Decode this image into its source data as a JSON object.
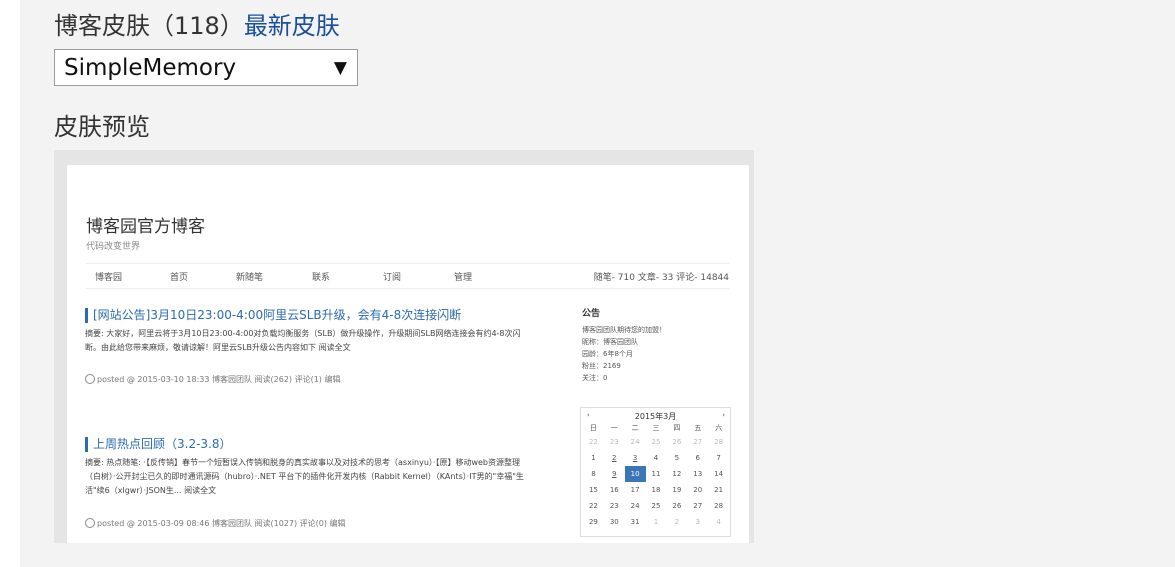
{
  "header": {
    "label": "博客皮肤（118）",
    "link": "最新皮肤"
  },
  "skin_select": {
    "value": "SimpleMemory",
    "arrow": "▼"
  },
  "preview": {
    "title": "皮肤预览",
    "blog": {
      "title": "博客园官方博客",
      "subtitle": "代码改变世界",
      "nav": [
        "博客园",
        "首页",
        "新随笔",
        "联系",
        "订阅",
        "管理"
      ],
      "stats": "随笔- 710  文章- 33  评论- 14844",
      "posts": [
        {
          "title": "[网站公告]3月10日23:00-4:00阿里云SLB升级，会有4-8次连接闪断",
          "body": "摘要: 大家好，阿里云将于3月10日23:00-4:00对负载均衡服务（SLB）做升级操作，升级期间SLB网络连接会有约4-8次闪断。由此给您带来麻烦，敬请谅解！阿里云SLB升级公告内容如下 阅读全文",
          "meta": "posted @ 2015-03-10 18:33 博客园团队 阅读(262) 评论(1) 编辑"
        },
        {
          "title": "上周热点回顾（3.2-3.8）",
          "body": "摘要: 热点随笔: ·【反传销】春节一个短暂误入传销和脱身的真实故事以及对技术的思考（asxinyu）·【原】移动web资源整理（白树）·公开封尘已久的即时通讯源码（hubro）·.NET 平台下的插件化开发内核（Rabbit Kernel）（KAnts）·IT男的\"幸福\"生活\"续6（xlgwr）·JSON生... 阅读全文",
          "meta": "posted @ 2015-03-09 08:46 博客园团队 阅读(1027) 评论(0) 编辑"
        }
      ],
      "notice": {
        "title": "公告",
        "lines": [
          "博客园团队期待您的加盟！",
          "昵称：博客园团队",
          "园龄：6年8个月",
          "粉丝：2169",
          "关注：0"
        ]
      },
      "calendar": {
        "prev": "‹",
        "next": "›",
        "month": "2015年3月",
        "weekdays": [
          "日",
          "一",
          "二",
          "三",
          "四",
          "五",
          "六"
        ],
        "rows": [
          [
            "22",
            "23",
            "24",
            "25",
            "26",
            "27",
            "28"
          ],
          [
            "1",
            "2",
            "3",
            "4",
            "5",
            "6",
            "7"
          ],
          [
            "8",
            "9",
            "10",
            "11",
            "12",
            "13",
            "14"
          ],
          [
            "15",
            "16",
            "17",
            "18",
            "19",
            "20",
            "21"
          ],
          [
            "22",
            "23",
            "24",
            "25",
            "26",
            "27",
            "28"
          ],
          [
            "29",
            "30",
            "31",
            "1",
            "2",
            "3",
            "4"
          ]
        ]
      }
    }
  }
}
